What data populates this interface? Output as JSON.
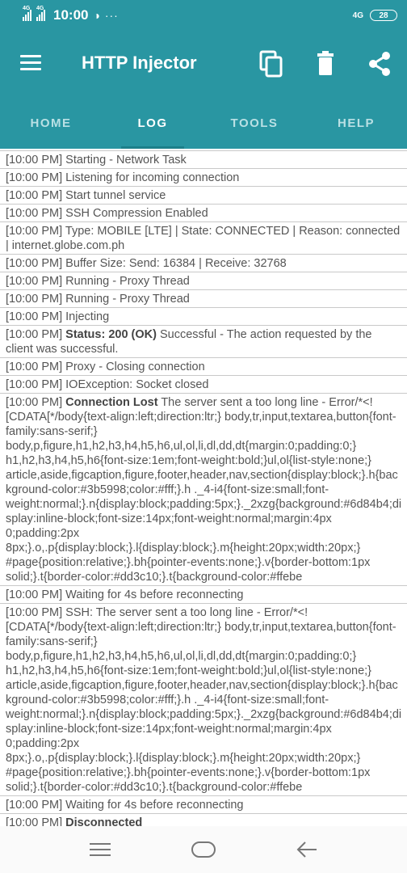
{
  "status_bar": {
    "signal_labels": [
      "4G",
      "4G"
    ],
    "time": "10:00",
    "left_icons": "◑ ···",
    "network": "4G",
    "battery": "28"
  },
  "app": {
    "title": "HTTP Injector"
  },
  "tabs": [
    {
      "label": "HOME",
      "active": false
    },
    {
      "label": "LOG",
      "active": true
    },
    {
      "label": "TOOLS",
      "active": false
    },
    {
      "label": "HELP",
      "active": false
    }
  ],
  "log": [
    {
      "ts": "[10:00 PM]",
      "bold": "",
      "text": "Starting - Network Task"
    },
    {
      "ts": "[10:00 PM]",
      "bold": "",
      "text": "Listening for incoming connection"
    },
    {
      "ts": "[10:00 PM]",
      "bold": "",
      "text": "Start tunnel service"
    },
    {
      "ts": "[10:00 PM]",
      "bold": "",
      "text": "SSH Compression Enabled"
    },
    {
      "ts": "[10:00 PM]",
      "bold": "",
      "text": "Type: MOBILE [LTE] | State: CONNECTED | Reason: connected | internet.globe.com.ph"
    },
    {
      "ts": "[10:00 PM]",
      "bold": "",
      "text": "Buffer Size: Send: 16384 | Receive: 32768"
    },
    {
      "ts": "[10:00 PM]",
      "bold": "",
      "text": "Running - Proxy Thread"
    },
    {
      "ts": "[10:00 PM]",
      "bold": "",
      "text": "Running - Proxy Thread"
    },
    {
      "ts": "[10:00 PM]",
      "bold": "",
      "text": "Injecting"
    },
    {
      "ts": "[10:00 PM]",
      "bold": "Status: 200 (OK)",
      "text": "Successful - The action requested by the client was successful."
    },
    {
      "ts": "[10:00 PM]",
      "bold": "",
      "text": "Proxy - Closing connection"
    },
    {
      "ts": "[10:00 PM]",
      "bold": "",
      "text": "IOException: Socket closed"
    },
    {
      "ts": "[10:00 PM]",
      "bold": "Connection Lost",
      "text": "The server sent a too long line - Error/*<![CDATA[*/body{text-align:left;direction:ltr;} body,tr,input,textarea,button{font-family:sans-serif;} body,p,figure,h1,h2,h3,h4,h5,h6,ul,ol,li,dl,dd,dt{margin:0;padding:0;} h1,h2,h3,h4,h5,h6{font-size:1em;font-weight:bold;}ul,ol{list-style:none;} article,aside,figcaption,figure,footer,header,nav,section{display:block;}.h{background-color:#3b5998;color:#fff;}.h ._4-i4{font-size:small;font-weight:normal;}.n{display:block;padding:5px;}._2xzg{background:#6d84b4;display:inline-block;font-size:14px;font-weight:normal;margin:4px 0;padding:2px 8px;}.o,.p{display:block;}.l{display:block;}.m{height:20px;width:20px;} #page{position:relative;}.bh{pointer-events:none;}.v{border-bottom:1px solid;}.t{border-color:#dd3c10;}.t{background-color:#ffebe"
    },
    {
      "ts": "[10:00 PM]",
      "bold": "",
      "text": "Waiting for 4s before reconnecting"
    },
    {
      "ts": "[10:00 PM]",
      "bold": "",
      "text": "SSH: The server sent a too long line - Error/*<![CDATA[*/body{text-align:left;direction:ltr;} body,tr,input,textarea,button{font-family:sans-serif;} body,p,figure,h1,h2,h3,h4,h5,h6,ul,ol,li,dl,dd,dt{margin:0;padding:0;} h1,h2,h3,h4,h5,h6{font-size:1em;font-weight:bold;}ul,ol{list-style:none;} article,aside,figcaption,figure,footer,header,nav,section{display:block;}.h{background-color:#3b5998;color:#fff;}.h ._4-i4{font-size:small;font-weight:normal;}.n{display:block;padding:5px;}._2xzg{background:#6d84b4;display:inline-block;font-size:14px;font-weight:normal;margin:4px 0;padding:2px 8px;}.o,.p{display:block;}.l{display:block;}.m{height:20px;width:20px;} #page{position:relative;}.bh{pointer-events:none;}.v{border-bottom:1px solid;}.t{border-color:#dd3c10;}.t{background-color:#ffebe"
    },
    {
      "ts": "[10:00 PM]",
      "bold": "",
      "text": "Waiting for 4s before reconnecting"
    },
    {
      "ts": "[10:00 PM]",
      "bold": "Disconnected",
      "text": ""
    }
  ],
  "colors": {
    "primary": "#2996a2",
    "tab_indicator": "#1c7f8a",
    "log_text": "#555555",
    "divider": "#c9c9c9"
  }
}
